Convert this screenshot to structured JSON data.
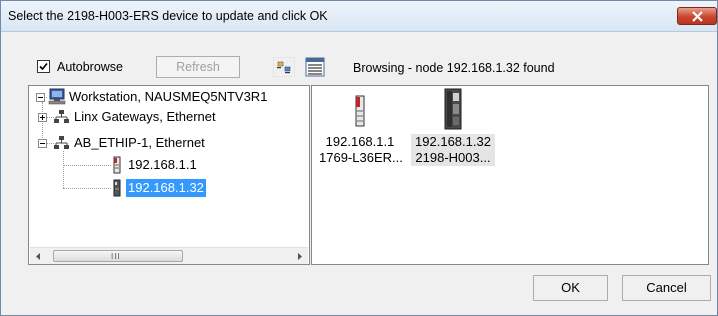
{
  "window": {
    "title": "Select the 2198-H003-ERS device to update and click OK"
  },
  "toolbar": {
    "autobrowse_label": "Autobrowse",
    "autobrowse_checked": true,
    "refresh_label": "Refresh",
    "status": "Browsing - node 192.168.1.32 found"
  },
  "tree": {
    "root": {
      "label": "Workstation, NAUSMEQ5NTV3R1",
      "icon": "workstation-icon"
    },
    "children": [
      {
        "label": "Linx Gateways, Ethernet",
        "icon": "network-icon",
        "expanded": false
      },
      {
        "label": "AB_ETHIP-1, Ethernet",
        "icon": "network-icon",
        "expanded": true,
        "children": [
          {
            "label": "192.168.1.1",
            "icon": "controller-icon"
          },
          {
            "label": "192.168.1.32",
            "icon": "drive-icon",
            "selected": true
          }
        ]
      }
    ],
    "scroll_grip": "III"
  },
  "devices": [
    {
      "ip": "192.168.1.1",
      "model": "1769-L36ER...",
      "icon": "controller-icon"
    },
    {
      "ip": "192.168.1.32",
      "model": "2198-H003...",
      "icon": "drive-icon",
      "selected": true
    }
  ],
  "buttons": {
    "ok": "OK",
    "cancel": "Cancel"
  }
}
